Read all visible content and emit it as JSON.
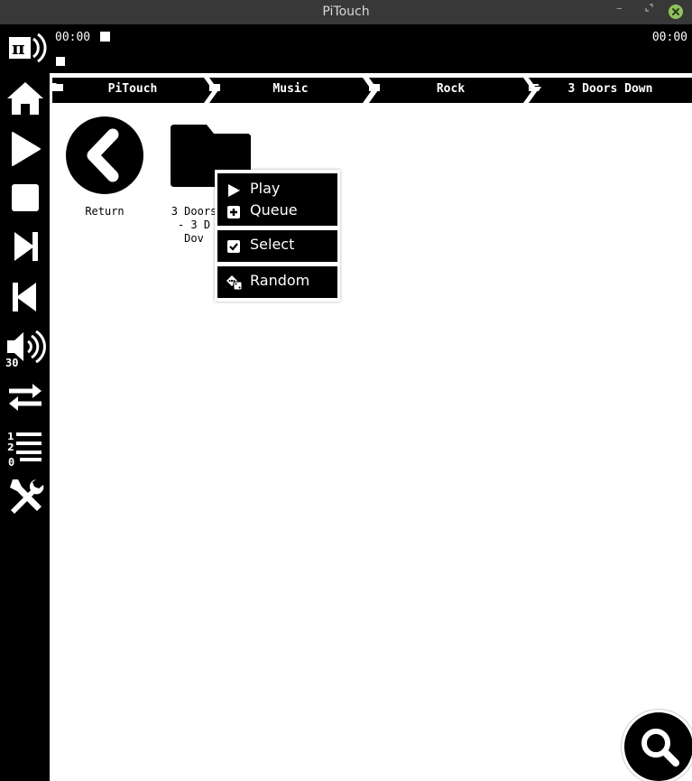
{
  "window": {
    "title": "PiTouch"
  },
  "player": {
    "elapsed": "00:00",
    "total": "00:00"
  },
  "sidebar": {
    "items": [
      {
        "icon": "pitouch-logo-icon"
      },
      {
        "icon": "home-icon"
      },
      {
        "icon": "play-icon"
      },
      {
        "icon": "stop-icon"
      },
      {
        "icon": "skip-next-icon"
      },
      {
        "icon": "skip-previous-icon"
      },
      {
        "icon": "volume-icon",
        "value": "30"
      },
      {
        "icon": "repeat-icon"
      },
      {
        "icon": "playlist-icon",
        "value": "0"
      },
      {
        "icon": "settings-tools-icon"
      }
    ]
  },
  "breadcrumb": [
    {
      "label": "PiTouch",
      "icon": "folder-icon"
    },
    {
      "label": "Music",
      "icon": "folder-icon"
    },
    {
      "label": "Rock",
      "icon": "folder-icon"
    },
    {
      "label": "3 Doors Down",
      "icon": "folder-open-icon"
    }
  ],
  "tiles": [
    {
      "label": "Return",
      "icon": "back-circle-icon"
    },
    {
      "label_lines": [
        "3 Doors",
        "- 3 D",
        "Dov"
      ],
      "icon": "folder-icon"
    }
  ],
  "context_menu": {
    "items": [
      {
        "label": "Play",
        "icon": "play-icon"
      },
      {
        "label": "Queue",
        "icon": "plus-square-icon"
      },
      {
        "label": "Select",
        "icon": "checkbox-checked-icon"
      },
      {
        "label": "Random",
        "icon": "dice-icon"
      }
    ]
  },
  "search": {
    "icon": "search-icon"
  },
  "colors": {
    "titlebar": "#383838",
    "close": "#8fc35b",
    "panel": "#000000"
  }
}
